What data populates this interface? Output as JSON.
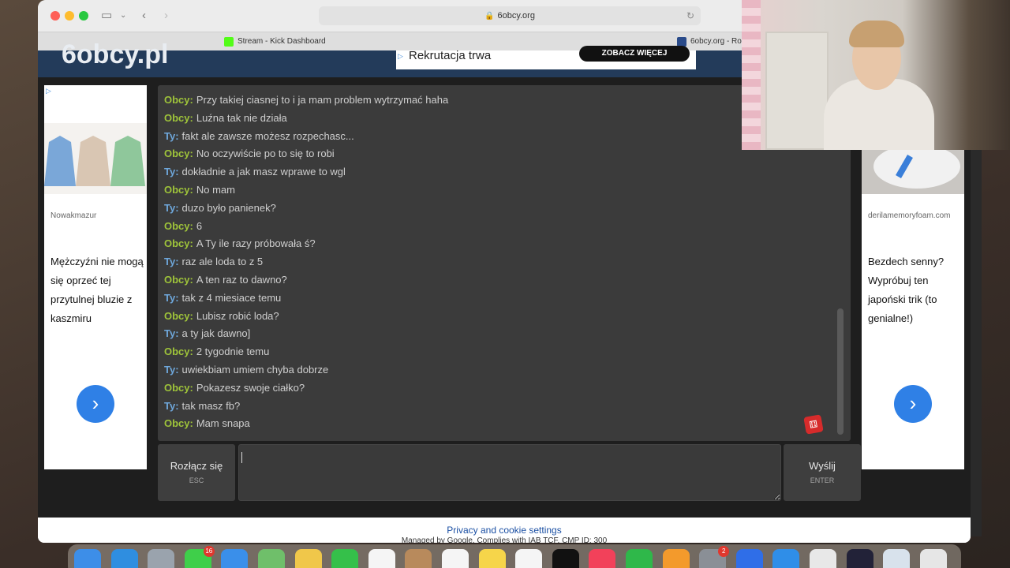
{
  "browser": {
    "url": "6obcy.org",
    "tabs": [
      {
        "label": "Stream - Kick Dashboard"
      },
      {
        "label": "6obcy.org - Ro"
      }
    ]
  },
  "site": {
    "logo_text": "6obcy.pl",
    "top_ad": {
      "text": "Rekrutacja trwa",
      "button": "ZOBACZ WIĘCEJ"
    }
  },
  "left_ad": {
    "source": "Nowakmazur",
    "body": "Mężczyźni nie mogą się oprzeć tej przytulnej bluzie z kaszmiru",
    "colors": [
      "#7aa7d8",
      "#d9c6b3",
      "#8fc79b"
    ]
  },
  "right_ad": {
    "source": "derilamemoryfoam.com",
    "body": "Bezdech senny? Wypróbuj ten japoński trik (to genialne!)"
  },
  "chat": {
    "messages": [
      {
        "who": "Obcy:",
        "text": "Przy takiej ciasnej to i ja mam problem wytrzymać haha",
        "from": "stranger"
      },
      {
        "who": "Obcy:",
        "text": "Luźna tak nie działa",
        "from": "stranger"
      },
      {
        "who": "Ty:",
        "text": "fakt ale zawsze możesz rozpechasc...",
        "from": "me"
      },
      {
        "who": "Obcy:",
        "text": "No oczywiście po to się to robi",
        "from": "stranger"
      },
      {
        "who": "Ty:",
        "text": "dokładnie a jak masz wprawe to wgl",
        "from": "me"
      },
      {
        "who": "Obcy:",
        "text": "No mam",
        "from": "stranger"
      },
      {
        "who": "Ty:",
        "text": "duzo było panienek?",
        "from": "me"
      },
      {
        "who": "Obcy:",
        "text": "6",
        "from": "stranger"
      },
      {
        "who": "Obcy:",
        "text": "A Ty ile razy próbowała ś?",
        "from": "stranger"
      },
      {
        "who": "Ty:",
        "text": "raz ale loda to z 5",
        "from": "me"
      },
      {
        "who": "Obcy:",
        "text": "A ten raz to dawno?",
        "from": "stranger"
      },
      {
        "who": "Ty:",
        "text": "tak z 4 miesiace temu",
        "from": "me"
      },
      {
        "who": "Obcy:",
        "text": "Lubisz robić loda?",
        "from": "stranger"
      },
      {
        "who": "Ty:",
        "text": "a ty jak dawno]",
        "from": "me"
      },
      {
        "who": "Obcy:",
        "text": "2 tygodnie temu",
        "from": "stranger"
      },
      {
        "who": "Ty:",
        "text": "uwiekbiam umiem chyba dobrze",
        "from": "me"
      },
      {
        "who": "Obcy:",
        "text": "Pokazesz swoje ciałko?",
        "from": "stranger"
      },
      {
        "who": "Ty:",
        "text": "tak masz fb?",
        "from": "me"
      },
      {
        "who": "Obcy:",
        "text": "Mam snapa",
        "from": "stranger"
      }
    ],
    "input_value": ""
  },
  "controls": {
    "disconnect_label": "Rozłącz się",
    "disconnect_hint": "ESC",
    "send_label": "Wyślij",
    "send_hint": "ENTER"
  },
  "footer": {
    "privacy": "Privacy and cookie settings",
    "managed": "Managed by Google. Complies with IAB TCF. CMP ID: 300"
  },
  "colors": {
    "stranger": "#9fc43a",
    "me": "#6fa8dc",
    "chat_bg": "#3b3b3b",
    "header": "#233b5a"
  },
  "dock": {
    "icons": [
      {
        "name": "finder-icon",
        "color": "#3d8ee8"
      },
      {
        "name": "safari-icon",
        "color": "#2f8ee0"
      },
      {
        "name": "launchpad-icon",
        "color": "#9aa3ad"
      },
      {
        "name": "messages-icon",
        "color": "#3fcf4a",
        "badge": "16"
      },
      {
        "name": "mail-icon",
        "color": "#3a8fea"
      },
      {
        "name": "maps-icon",
        "color": "#6fbf6a"
      },
      {
        "name": "photos-icon",
        "color": "#f0c74a"
      },
      {
        "name": "facetime-icon",
        "color": "#35c04a"
      },
      {
        "name": "calendar-icon",
        "color": "#f5f5f5"
      },
      {
        "name": "contacts-icon",
        "color": "#b88a5c"
      },
      {
        "name": "reminders-icon",
        "color": "#f5f5f5"
      },
      {
        "name": "notes-icon",
        "color": "#f6d54a"
      },
      {
        "name": "freeform-icon",
        "color": "#f5f5f5"
      },
      {
        "name": "appletv-icon",
        "color": "#111111"
      },
      {
        "name": "music-icon",
        "color": "#f2415a"
      },
      {
        "name": "numbers-icon",
        "color": "#2fb84a"
      },
      {
        "name": "pages-icon",
        "color": "#f39a2c"
      },
      {
        "name": "settings-icon",
        "color": "#8a8f96",
        "badge": "2"
      },
      {
        "name": "roblox-icon",
        "color": "#2f6ee8"
      },
      {
        "name": "appstore-icon",
        "color": "#2f8ee8"
      },
      {
        "name": "chrome-icon",
        "color": "#e8e8e8"
      },
      {
        "name": "obs-icon",
        "color": "#222238"
      },
      {
        "name": "preview-icon",
        "color": "#d8e2ec"
      },
      {
        "name": "trash-icon",
        "color": "#e6e6e6"
      }
    ]
  }
}
